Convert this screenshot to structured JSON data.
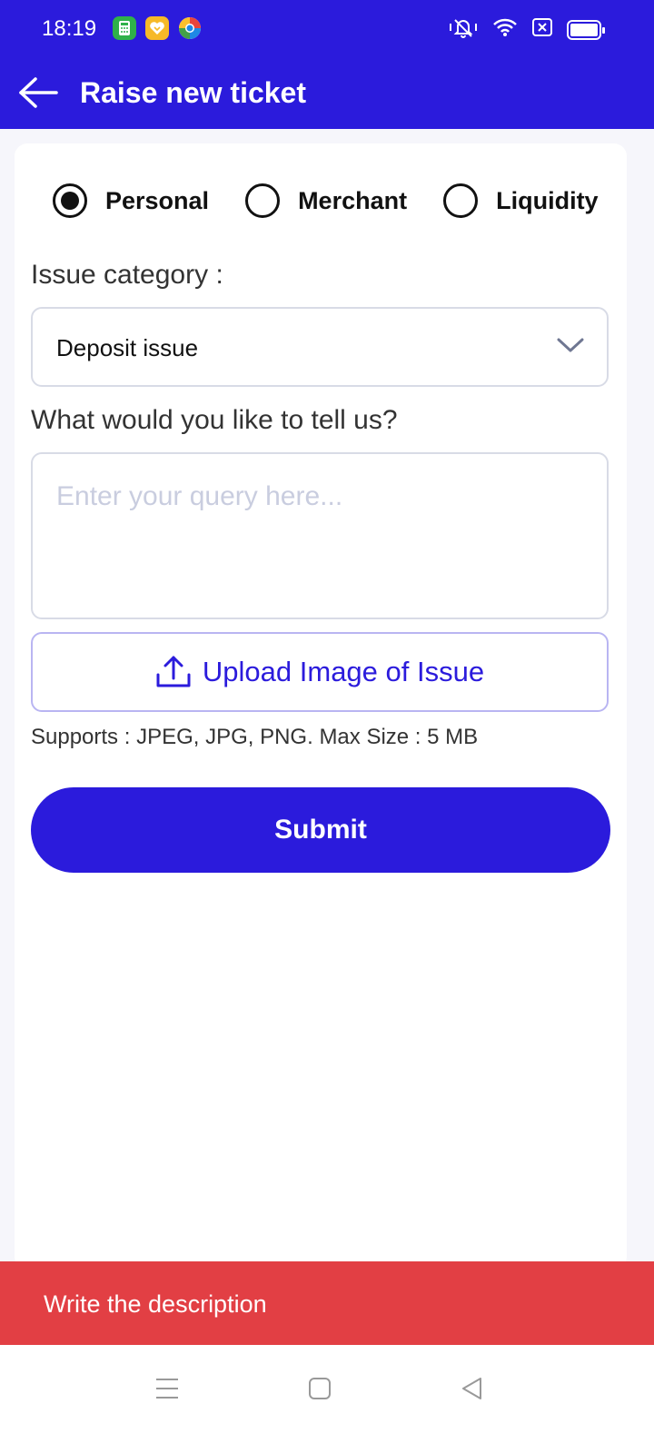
{
  "status_bar": {
    "time": "18:19",
    "app_icons": [
      "calculator-app-icon",
      "heart-app-icon",
      "edge-browser-icon"
    ],
    "right_icons": [
      "mute-icon",
      "wifi-icon",
      "sim-icon",
      "battery-icon"
    ]
  },
  "header": {
    "title": "Raise new ticket",
    "back_icon": "arrow-left-icon",
    "color": "#2b1bdc"
  },
  "account_types": [
    {
      "label": "Personal",
      "selected": true
    },
    {
      "label": "Merchant",
      "selected": false
    },
    {
      "label": "Liquidity",
      "selected": false
    }
  ],
  "form": {
    "category_label": "Issue category :",
    "category_value": "Deposit issue",
    "query_label": "What would you like to tell us?",
    "query_placeholder": "Enter your query here...",
    "query_value": "",
    "upload_label": "Upload Image of Issue",
    "support_text": "Supports : JPEG, JPG, PNG. Max Size : 5 MB",
    "submit_label": "Submit"
  },
  "toast": {
    "message": "Write the description",
    "color": "#e23f44"
  },
  "nav_bar": [
    "menu-icon",
    "home-square-icon",
    "back-triangle-icon"
  ]
}
